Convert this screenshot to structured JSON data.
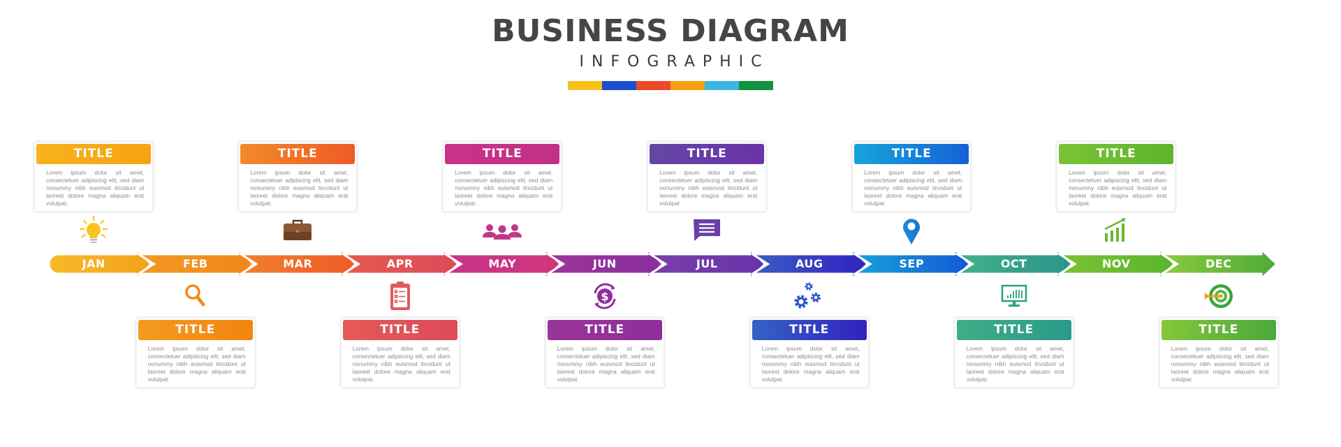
{
  "header": {
    "title": "BUSINESS DIAGRAM",
    "subtitle": "INFOGRAPHIC",
    "color_bar": [
      "#f7c21a",
      "#1b4fcf",
      "#ee4a2a",
      "#f5a012",
      "#3bb6e0",
      "#14923f"
    ]
  },
  "months": [
    {
      "label": "JAN",
      "title": "TITLE",
      "icon": "lightbulb-icon",
      "position": "top",
      "c1": "#f7b21e",
      "c2": "#f6a313",
      "text": "Lorem ipsum dolor sit amet, consectetuer adipiscing elit, sed diam nonummy nibh euismod tincidunt ut laoreet dolore magna aliquam erat volutpat."
    },
    {
      "label": "FEB",
      "title": "TITLE",
      "icon": "magnifier-icon",
      "position": "bottom",
      "c1": "#f39a21",
      "c2": "#f2850f",
      "text": "Lorem ipsum dolor sit amet, consectetuer adipiscing elit, sed diam nonummy nibh euismod tincidunt ut laoreet dolore magna aliquam erat volutpat."
    },
    {
      "label": "MAR",
      "title": "TITLE",
      "icon": "briefcase-icon",
      "position": "top",
      "c1": "#f28a2a",
      "c2": "#ee5a26",
      "text": "Lorem ipsum dolor sit amet, consectetuer adipiscing elit, sed diam nonummy nibh euismod tincidunt ut laoreet dolore magna aliquam erat volutpat."
    },
    {
      "label": "APR",
      "title": "TITLE",
      "icon": "clipboard-icon",
      "position": "bottom",
      "c1": "#e45a55",
      "c2": "#de4a5a",
      "text": "Lorem ipsum dolor sit amet, consectetuer adipiscing elit, sed diam nonummy nibh euismod tincidunt ut laoreet dolore magna aliquam erat volutpat."
    },
    {
      "label": "MAY",
      "title": "TITLE",
      "icon": "team-icon",
      "position": "top",
      "c1": "#c8338a",
      "c2": "#c23187",
      "text": "Lorem ipsum dolor sit amet, consectetuer adipiscing elit, sed diam nonummy nibh euismod tincidunt ut laoreet dolore magna aliquam erat volutpat."
    },
    {
      "label": "JUN",
      "title": "TITLE",
      "icon": "dollar-cycle-icon",
      "position": "bottom",
      "c1": "#9a3598",
      "c2": "#8e2f9c",
      "text": "Lorem ipsum dolor sit amet, consectetuer adipiscing elit, sed diam nonummy nibh euismod tincidunt ut laoreet dolore magna aliquam erat volutpat."
    },
    {
      "label": "JUL",
      "title": "TITLE",
      "icon": "chat-icon",
      "position": "top",
      "c1": "#6447a5",
      "c2": "#6a33a8",
      "text": "Lorem ipsum dolor sit amet, consectetuer adipiscing elit, sed diam nonummy nibh euismod tincidunt ut laoreet dolore magna aliquam erat volutpat."
    },
    {
      "label": "AUG",
      "title": "TITLE",
      "icon": "gears-icon",
      "position": "bottom",
      "c1": "#3364c4",
      "c2": "#3321c0",
      "text": "Lorem ipsum dolor sit amet, consectetuer adipiscing elit, sed diam nonummy nibh euismod tincidunt ut laoreet dolore magna aliquam erat volutpat."
    },
    {
      "label": "SEP",
      "title": "TITLE",
      "icon": "location-pin-icon",
      "position": "top",
      "c1": "#17a5db",
      "c2": "#1560d8",
      "text": "Lorem ipsum dolor sit amet, consectetuer adipiscing elit, sed diam nonummy nibh euismod tincidunt ut laoreet dolore magna aliquam erat volutpat."
    },
    {
      "label": "OCT",
      "title": "TITLE",
      "icon": "monitor-chart-icon",
      "position": "bottom",
      "c1": "#3fae87",
      "c2": "#2a9a8a",
      "text": "Lorem ipsum dolor sit amet, consectetuer adipiscing elit, sed diam nonummy nibh euismod tincidunt ut laoreet dolore magna aliquam erat volutpat."
    },
    {
      "label": "NOV",
      "title": "TITLE",
      "icon": "growth-chart-icon",
      "position": "top",
      "c1": "#7cc235",
      "c2": "#5cb52b",
      "text": "Lorem ipsum dolor sit amet, consectetuer adipiscing elit, sed diam nonummy nibh euismod tincidunt ut laoreet dolore magna aliquam erat volutpat."
    },
    {
      "label": "DEC",
      "title": "TITLE",
      "icon": "target-icon",
      "position": "bottom",
      "c1": "#86c63a",
      "c2": "#4aa83a",
      "text": "Lorem ipsum dolor sit amet, consectetuer adipiscing elit, sed diam nonummy nibh euismod tincidunt ut laoreet dolore magna aliquam erat volutpat."
    }
  ],
  "arrow_colors": [
    [
      "#f8b82a",
      "#f4a319"
    ],
    [
      "#f39a22",
      "#f2861a"
    ],
    [
      "#f1802e",
      "#ee5b26"
    ],
    [
      "#e65a4d",
      "#dd4a5a"
    ],
    [
      "#c8338a",
      "#d0367e"
    ],
    [
      "#9a3598",
      "#8a2fa0"
    ],
    [
      "#7a3fa6",
      "#6a33aa"
    ],
    [
      "#3a5cc3",
      "#3322c2"
    ],
    [
      "#16a3da",
      "#1458d6"
    ],
    [
      "#43b08a",
      "#2a958a"
    ],
    [
      "#7cc235",
      "#5ab52b"
    ],
    [
      "#8ccb3e",
      "#4ea93a"
    ]
  ]
}
